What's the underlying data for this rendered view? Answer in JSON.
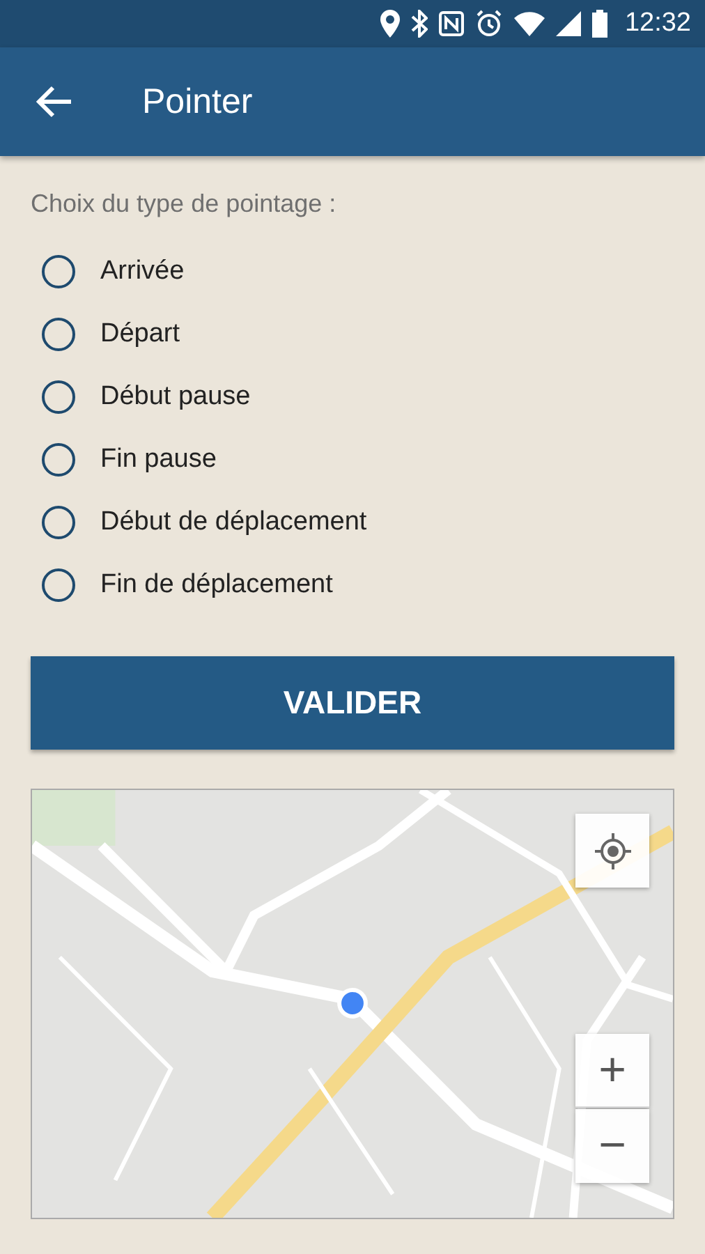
{
  "status_bar": {
    "time": "12:32"
  },
  "app_bar": {
    "title": "Pointer"
  },
  "prompt": "Choix du type de pointage :",
  "options": [
    {
      "label": "Arrivée",
      "selected": false
    },
    {
      "label": "Départ",
      "selected": false
    },
    {
      "label": "Début pause",
      "selected": false
    },
    {
      "label": "Fin pause",
      "selected": false
    },
    {
      "label": "Début de déplacement",
      "selected": false
    },
    {
      "label": "Fin de déplacement",
      "selected": false
    }
  ],
  "submit": "VALIDER",
  "map": {
    "kind": "picture",
    "zoom_in": "+",
    "zoom_out": "−"
  }
}
